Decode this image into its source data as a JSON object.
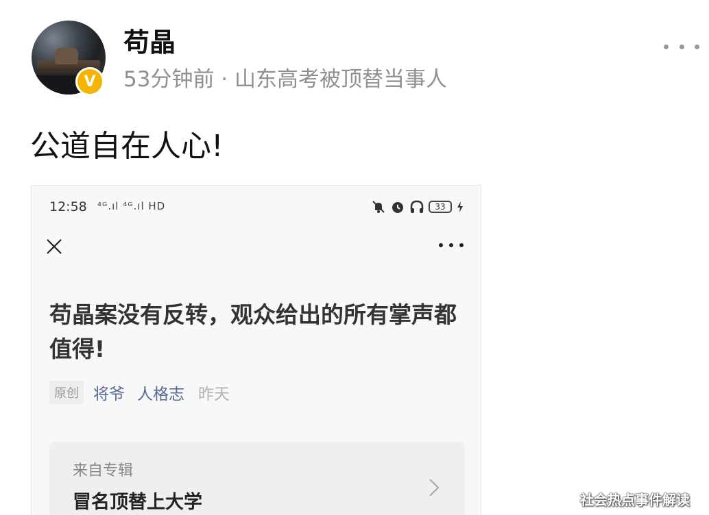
{
  "post": {
    "username": "苟晶",
    "verified_badge": "V",
    "meta": "53分钟前 · 山东高考被顶替当事人",
    "text": "公道自在人心!"
  },
  "embedded_screenshot": {
    "status_bar": {
      "time": "12:58",
      "network": "⁴ᴳ.ıl ⁴ᴳ.ıl HD",
      "battery": "33"
    },
    "article": {
      "title": "苟晶案没有反转，观众给出的所有掌声都值得!",
      "original_tag": "原创",
      "author": "将爷",
      "account": "人格志",
      "date": "昨天"
    },
    "album": {
      "from_label": "来自专辑",
      "name": "冒名顶替上大学"
    }
  },
  "watermark": "社会热点事件解读",
  "colors": {
    "link_blue": "#576b95",
    "badge_gold": "#f5b400",
    "meta_gray": "#8f8f8f"
  },
  "icons": [
    "more-icon",
    "verified-badge-icon",
    "close-icon",
    "dots-icon",
    "chevron-right-icon",
    "mute-icon",
    "alarm-icon",
    "headphone-icon",
    "charging-icon"
  ]
}
